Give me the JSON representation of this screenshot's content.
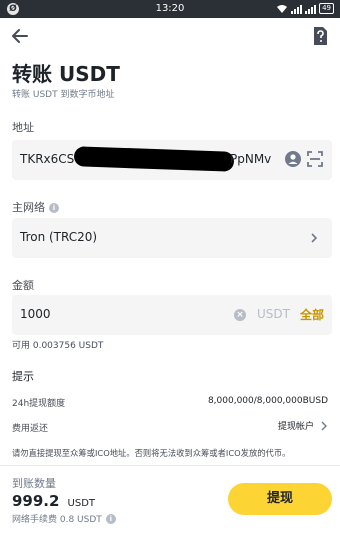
{
  "status_bar": {
    "left_badge": "Ø",
    "time": "13:20",
    "battery": "49"
  },
  "header": {
    "title": "转账 USDT",
    "subtitle": "转账 USDT 到数字币地址"
  },
  "address": {
    "label": "地址",
    "value_prefix": "TKRx6CS",
    "value_suffix": "PpNMv"
  },
  "network": {
    "label": "主网络",
    "value": "Tron (TRC20)"
  },
  "amount": {
    "label": "金额",
    "value": "1000",
    "unit": "USDT",
    "all_label": "全部",
    "available": "可用 0.003756 USDT"
  },
  "tips": {
    "heading": "提示",
    "limit_label": "24h提现额度",
    "limit_value": "8,000,000/8,000,000BUSD",
    "fee_return_label": "费用返还",
    "fee_return_link": "提现帐户",
    "warning": "请勿直接提现至众筹或ICO地址。否则将无法收到众筹或者ICO发放的代币。"
  },
  "footer": {
    "receive_label": "到账数量",
    "receive_amount": "999.2",
    "receive_unit": "USDT",
    "fee_text": "网络手续费 0.8 USDT",
    "withdraw_label": "提现"
  }
}
